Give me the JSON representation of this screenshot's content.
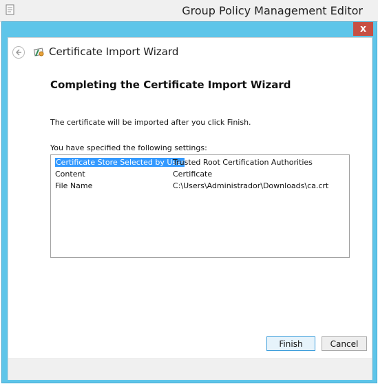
{
  "background_window": {
    "title": "Group Policy Management Editor",
    "icon": "document-icon"
  },
  "window": {
    "close_label": "x"
  },
  "wizard": {
    "title": "Certificate Import Wizard",
    "back_icon": "back-arrow-icon",
    "icon": "certificate-icon",
    "heading": "Completing the Certificate Import Wizard",
    "info_text": "The certificate will be imported after you click Finish.",
    "settings_label": "You have specified the following settings:",
    "settings": [
      {
        "key": "Certificate Store Selected by User",
        "value": "Trusted Root Certification Authorities",
        "selected": true
      },
      {
        "key": "Content",
        "value": "Certificate",
        "selected": false
      },
      {
        "key": "File Name",
        "value": "C:\\Users\\Administrador\\Downloads\\ca.crt",
        "selected": false
      }
    ]
  },
  "buttons": {
    "finish": "Finish",
    "cancel": "Cancel"
  },
  "colors": {
    "frame": "#5ec5e9",
    "close": "#c74f43",
    "selection": "#3399ff",
    "finish_border": "#3c9ddb"
  }
}
